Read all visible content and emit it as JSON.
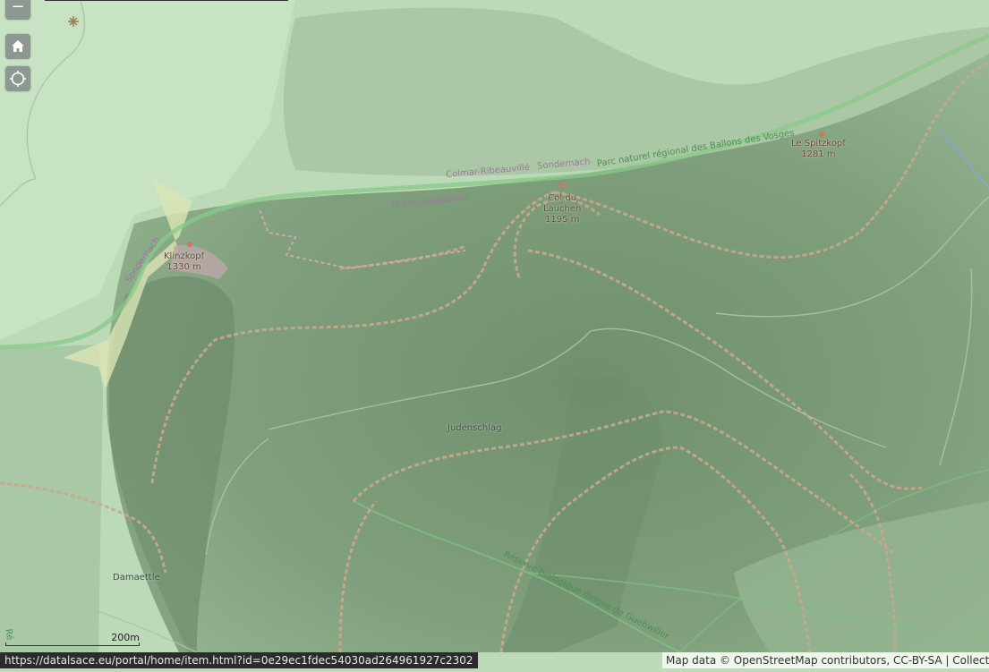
{
  "controls": {
    "zoom_out_symbol": "−",
    "home_icon": "home-icon",
    "locate_icon": "locate-icon"
  },
  "map": {
    "base_color": "#bcd9b8",
    "forest_color": "#7f9e7c",
    "trail_color": "#c9a98c",
    "boundary_color": "#7fbf80",
    "labels": {
      "peak_1_name": "Klinzkopf",
      "peak_1_elev": "1330 m",
      "peak_2_name": "Col du",
      "peak_2_name_2": "Lauchen",
      "peak_2_elev": "1195 m",
      "peak_3_name": "Le Spitzkopf",
      "peak_3_elev": "1281 m",
      "boundary_1": "Colmar-Ribeauvillé",
      "boundary_2": "Sondernach",
      "boundary_3": "Thann-Guebwiller",
      "boundary_4": "Sondernach",
      "park": "Parc naturel régional des Ballons des Vosges",
      "place_1": "Judenschlag",
      "place_2": "Damaettle",
      "reserve": "Réserve biologique dirigée de Guebwiller",
      "edge_fragment": "Ré"
    }
  },
  "scale": {
    "label": "200m"
  },
  "status_url": "https://datalsace.eu/portal/home/item.html?id=0e29ec1fdec54030ad264961927c2302",
  "attribution": "Map data © OpenStreetMap contributors, CC-BY-SA | Collective"
}
